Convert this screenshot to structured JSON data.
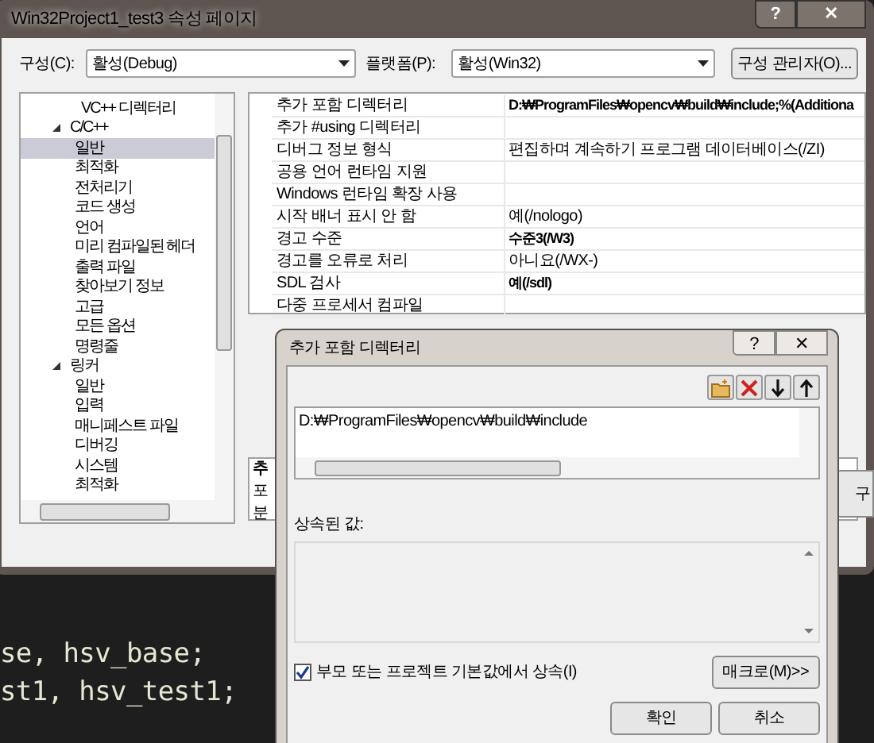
{
  "window": {
    "title": "Win32Project1_test3 속성 페이지",
    "help": "?",
    "close": "✕"
  },
  "config": {
    "label": "구성(C):",
    "value": "활성(Debug)"
  },
  "platform": {
    "label": "플랫폼(P):",
    "value": "활성(Win32)"
  },
  "config_manager_button": "구성 관리자(O)...",
  "tree": [
    {
      "label": "VC++ 디렉터리",
      "selected": false
    },
    {
      "label": "C/C++",
      "expanded": true,
      "selected": false,
      "children": [
        {
          "label": "일반",
          "selected": true
        },
        {
          "label": "최적화",
          "selected": false
        },
        {
          "label": "전처리기",
          "selected": false
        },
        {
          "label": "코드 생성",
          "selected": false
        },
        {
          "label": "언어",
          "selected": false
        },
        {
          "label": "미리 컴파일된 헤더",
          "selected": false
        },
        {
          "label": "출력 파일",
          "selected": false
        },
        {
          "label": "찾아보기 정보",
          "selected": false
        },
        {
          "label": "고급",
          "selected": false
        },
        {
          "label": "모든 옵션",
          "selected": false
        },
        {
          "label": "명령줄",
          "selected": false
        }
      ]
    },
    {
      "label": "링커",
      "expanded": true,
      "selected": false,
      "children": [
        {
          "label": "일반",
          "selected": false
        },
        {
          "label": "입력",
          "selected": false
        },
        {
          "label": "매니페스트 파일",
          "selected": false
        },
        {
          "label": "디버깅",
          "selected": false
        },
        {
          "label": "시스템",
          "selected": false
        },
        {
          "label": "최적화",
          "selected": false
        }
      ]
    }
  ],
  "properties": [
    {
      "name": "추가 포함 디렉터리",
      "value": "D:₩ProgramFiles₩opencv₩build₩include;%(Additiona",
      "modified": true
    },
    {
      "name": "추가 #using 디렉터리"
    },
    {
      "name": "디버그 정보 형식",
      "value": "편집하며 계속하기 프로그램 데이터베이스(/ZI)",
      "modified": false
    },
    {
      "name": "공용 언어 런타임 지원"
    },
    {
      "name": "Windows 런타임 확장 사용"
    },
    {
      "name": "시작 배너 표시 안 함",
      "value": "예(/nologo)",
      "modified": false
    },
    {
      "name": "경고 수준",
      "value": "수준3(/W3)",
      "modified": true
    },
    {
      "name": "경고를 오류로 처리",
      "value": "아니요(/WX-)",
      "modified": false
    },
    {
      "name": "SDL 검사",
      "value": "예(/sdl)",
      "modified": true
    },
    {
      "name": "다중 프로세서 컴파일"
    }
  ],
  "description": {
    "title": "추",
    "lines": [
      "포",
      "분"
    ]
  },
  "side_button_fragment": "구",
  "dialog": {
    "title": "추가 포함 디렉터리",
    "help": "?",
    "close": "✕",
    "toolbar": [
      {
        "kind": "new_folder"
      },
      {
        "kind": "delete"
      },
      {
        "kind": "move_down"
      },
      {
        "kind": "move_up"
      }
    ],
    "entries": [
      "D:₩ProgramFiles₩opencv₩build₩include"
    ],
    "inherited_label": "상속된 값:",
    "inherit": {
      "label": "부모 또는 프로젝트 기본값에서 상속(I)",
      "checked": true
    },
    "macros_button": "매크로(M)>>",
    "ok_button": "확인",
    "cancel_button": "취소"
  },
  "code_lines": [
    "se, hsv_base;",
    "st1, hsv_test1;"
  ]
}
